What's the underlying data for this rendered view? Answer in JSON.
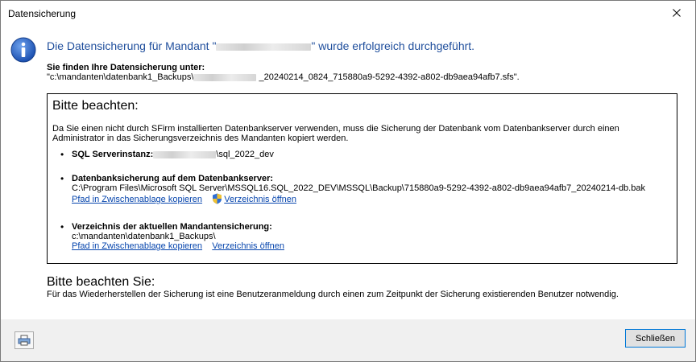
{
  "window": {
    "title": "Datensicherung",
    "close_glyph": "✕"
  },
  "header": {
    "headline_prefix": "Die Datensicherung für Mandant \"",
    "headline_suffix": "\" wurde erfolgreich durchgeführt.",
    "icon": "info-icon",
    "accent_color": "#1f4e9c"
  },
  "location": {
    "label": "Sie finden Ihre Datensicherung unter:",
    "path_prefix": "\"c:\\mandanten\\datenbank1_Backups\\",
    "path_suffix": "_20240214_0824_715880a9-5292-4392-a802-db9aea94afb7.sfs\"."
  },
  "notice": {
    "title": "Bitte beachten:",
    "description": "Da Sie einen nicht durch SFirm installierten Datenbankserver verwenden, muss die Sicherung der Datenbank vom Datenbankserver durch einen Administrator in das Sicherungsverzeichnis des Mandanten kopiert werden.",
    "server_label": "SQL Serverinstanz:",
    "server_suffix": "\\sql_2022_dev",
    "db_backup_label": "Datenbanksicherung auf dem Datenbankserver:",
    "db_backup_path": "C:\\Program Files\\Microsoft SQL Server\\MSSQL16.SQL_2022_DEV\\MSSQL\\Backup\\715880a9-5292-4392-a802-db9aea94afb7_20240214-db.bak",
    "copy_path_link_1": "Pfad in Zwischenablage kopieren",
    "open_dir_link_1": "Verzeichnis öffnen",
    "mandant_dir_label": "Verzeichnis der aktuellen Mandantensicherung:",
    "mandant_dir_path": "c:\\mandanten\\datenbank1_Backups\\",
    "copy_path_link_2": "Pfad in Zwischenablage kopieren",
    "open_dir_link_2": "Verzeichnis öffnen",
    "bullet": "•"
  },
  "note": {
    "title": "Bitte beachten Sie:",
    "text": "Für das Wiederherstellen der Sicherung ist eine Benutzeranmeldung durch einen zum Zeitpunkt der Sicherung existierenden Benutzer notwendig."
  },
  "footer": {
    "icon": "print-icon",
    "close_label": "Schließen"
  },
  "colors": {
    "link": "#0645ad",
    "footer_bg": "#f0f0f0",
    "button_border": "#0078d7"
  }
}
